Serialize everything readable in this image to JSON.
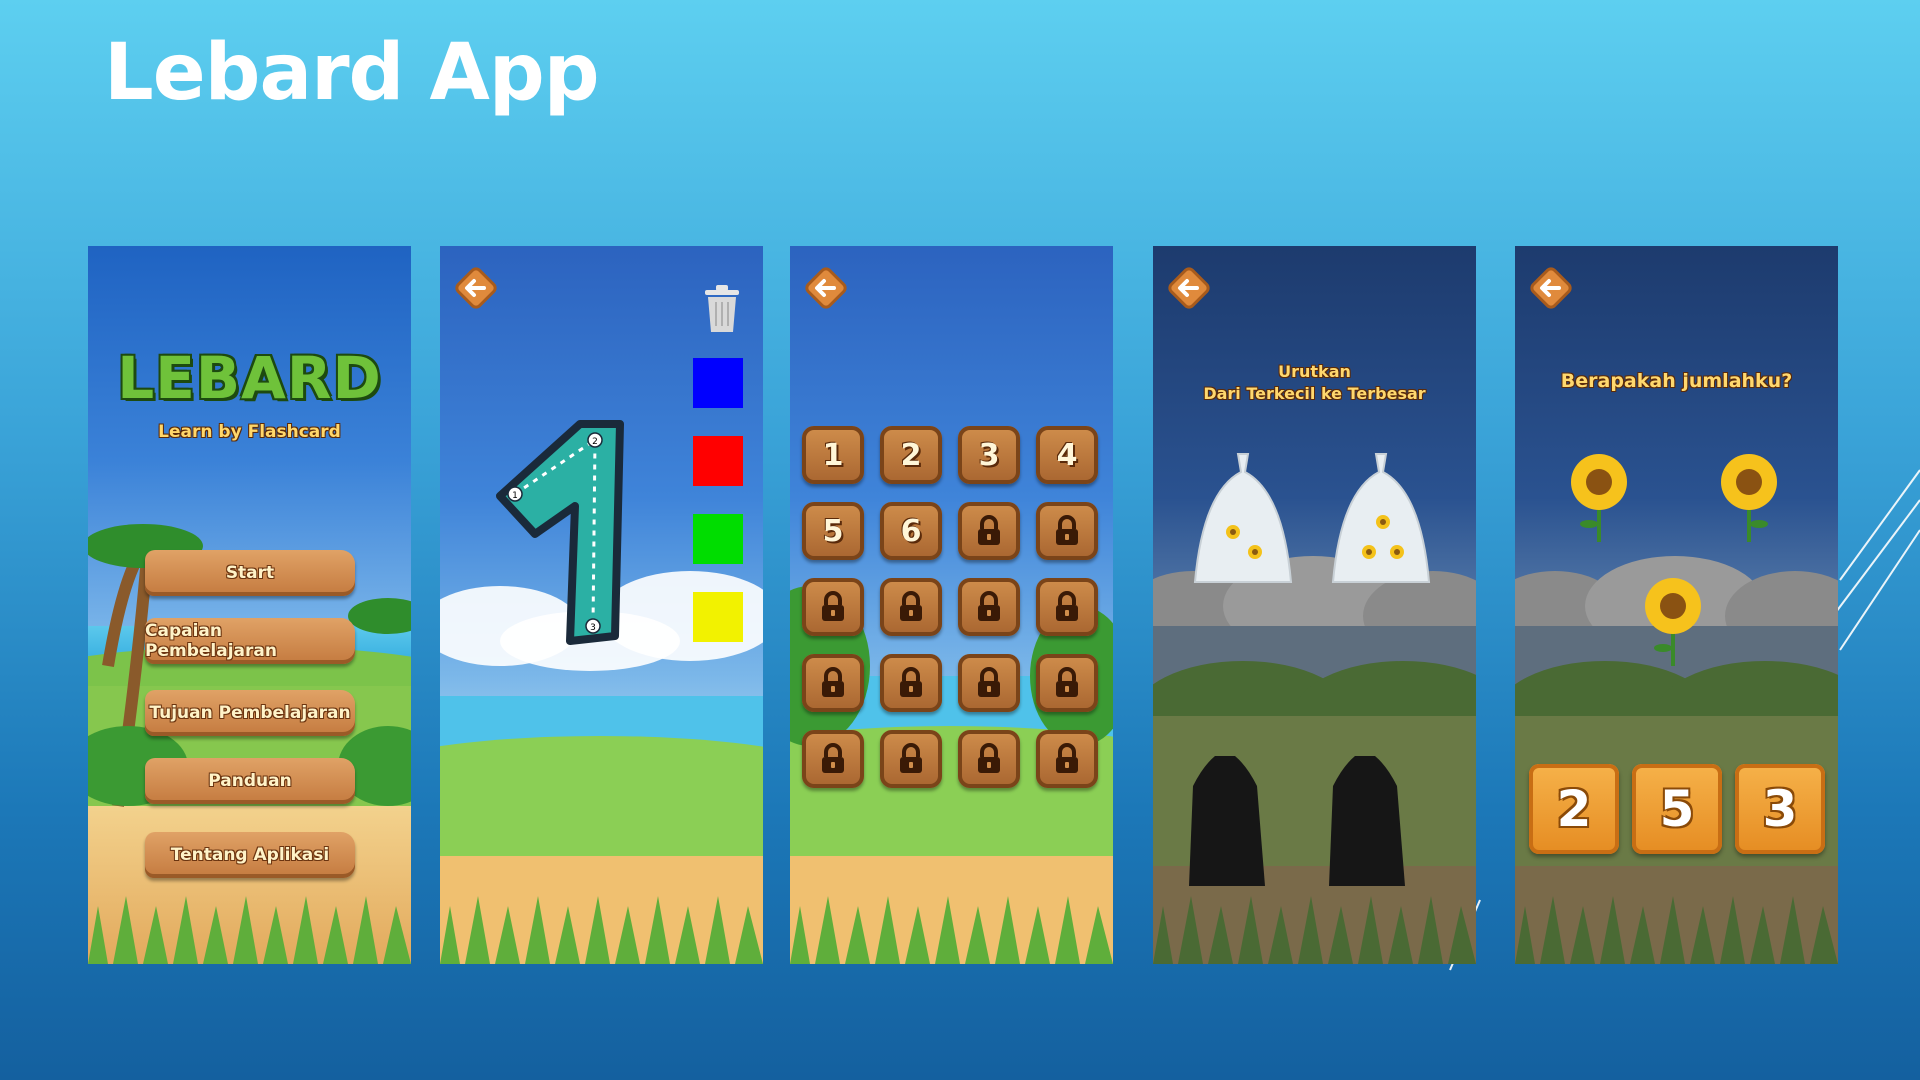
{
  "slide": {
    "title": "Lebard App"
  },
  "colors": {
    "wood": "#c47a3f",
    "swatch_blue": "#0000ff",
    "swatch_red": "#ff0000",
    "swatch_green": "#00dd00",
    "swatch_yellow": "#f2f200"
  },
  "menu_screen": {
    "logo": "LEBARD",
    "tagline": "Learn by Flashcard",
    "buttons": [
      "Start",
      "Capaian Pembelajaran",
      "Tujuan Pembelajaran",
      "Panduan",
      "Tentang Aplikasi"
    ]
  },
  "trace_screen": {
    "digit": "1",
    "stroke_points": [
      "1",
      "2",
      "3"
    ],
    "tools": [
      "trash-icon",
      "blue",
      "red",
      "green",
      "yellow"
    ]
  },
  "level_screen": {
    "unlocked": [
      "1",
      "2",
      "3",
      "4",
      "5",
      "6"
    ],
    "locked_count_label": "lock-icon"
  },
  "order_screen": {
    "title_line1": "Urutkan",
    "title_line2": "Dari Terkecil ke Terbesar"
  },
  "count_screen": {
    "title": "Berapakah jumlahku?",
    "answers": [
      "2",
      "5",
      "3"
    ]
  }
}
